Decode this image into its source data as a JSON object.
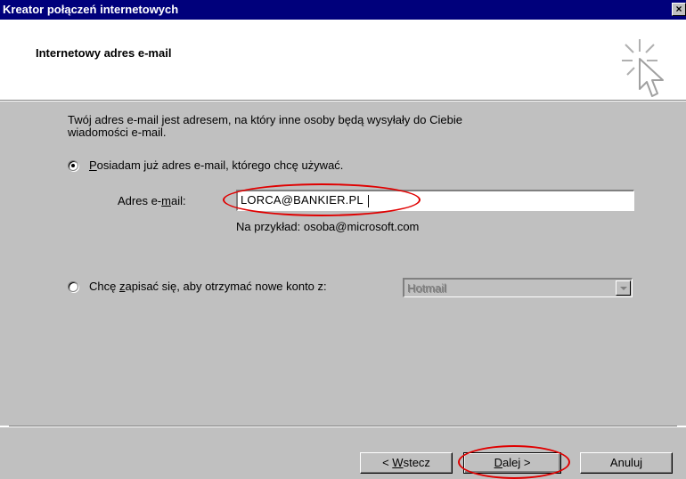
{
  "window": {
    "title": "Kreator połączeń internetowych",
    "close_glyph": "×"
  },
  "header": {
    "title": "Internetowy adres e-mail",
    "icon": "wizard-cursor-icon"
  },
  "content": {
    "intro_line1": "Twój adres e-mail jest adresem, na który inne osoby będą wysyłały do Ciebie",
    "intro_line2": "wiadomości e-mail.",
    "option_existing": {
      "first_letter": "P",
      "rest": "osiadam już adres e-mail, którego chcę używać.",
      "selected": true
    },
    "email": {
      "label_pre": "Adres e-",
      "label_underlined": "m",
      "label_post": "ail:",
      "value": "LORCA@BANKIER.PL",
      "example": "Na przykład: osoba@microsoft.com"
    },
    "option_new": {
      "pre": "Chcę ",
      "underlined": "z",
      "post": "apisać się, aby otrzymać nowe konto z:",
      "selected": false
    },
    "provider_select": {
      "value": "Hotmail",
      "enabled": false
    }
  },
  "footer": {
    "back_pre": "< ",
    "back_underlined": "W",
    "back_post": "stecz",
    "next_underlined": "D",
    "next_post": "alej >",
    "cancel": "Anuluj"
  },
  "colors": {
    "titlebar": "#00007b",
    "face": "#c0c0c0",
    "highlight_ellipse": "#e00000"
  }
}
